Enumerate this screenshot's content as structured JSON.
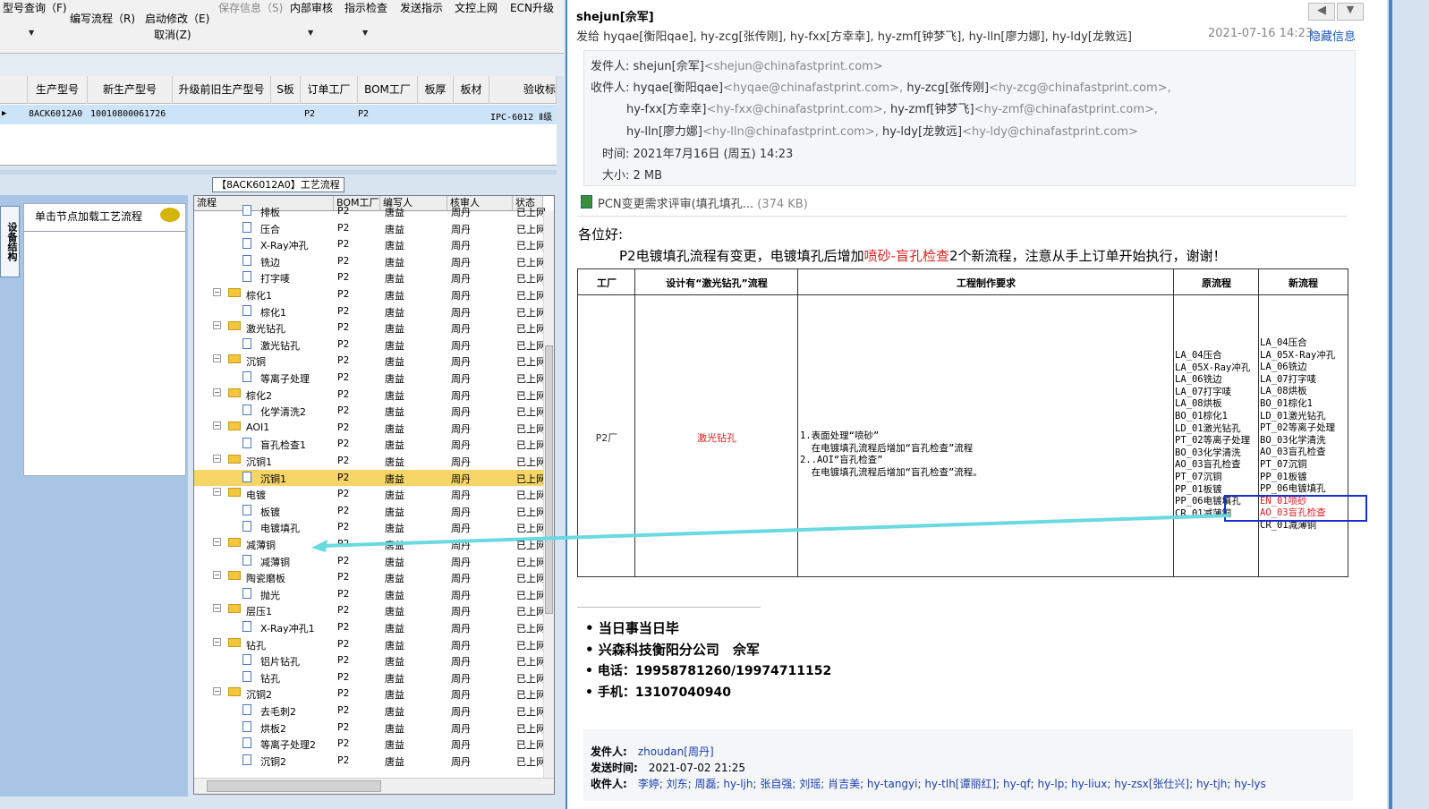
{
  "toolbar": {
    "items": [
      "型号查询（F)",
      "编写流程（R)",
      "启动修改（E)",
      "保存信息（S)",
      "内部审核",
      "指示检查",
      "发送指示",
      "文控上网",
      "ECN升级"
    ],
    "cancel": "取消(Z)"
  },
  "grid": {
    "headers": [
      "生产型号",
      "新生产型号",
      "升级前旧生产型号",
      "S板",
      "订单工厂",
      "BOM工厂",
      "板厚",
      "板材",
      "验收标"
    ],
    "row": {
      "model": "8ACK6012A0",
      "new_model": "10010800061726",
      "s": "",
      "order_factory": "P2",
      "bom_factory": "P2",
      "standard": "IPC-6012 Ⅱ级"
    }
  },
  "workflow_title": "【8ACK6012A0】工艺流程",
  "side_tab": "设备结构",
  "hint_panel": {
    "title": "单击节点加载工艺流程"
  },
  "tree": {
    "headers": [
      "流程",
      "BOM工厂",
      "编写人",
      "核审人",
      "状态"
    ],
    "rows": [
      {
        "level": 2,
        "type": "doc",
        "name": "排板",
        "bom": "P2",
        "author": "唐益",
        "reviewer": "周丹",
        "status": "已上网"
      },
      {
        "level": 2,
        "type": "doc",
        "name": "压合",
        "bom": "P2",
        "author": "唐益",
        "reviewer": "周丹",
        "status": "已上网"
      },
      {
        "level": 2,
        "type": "doc",
        "name": "X-Ray冲孔",
        "bom": "P2",
        "author": "唐益",
        "reviewer": "周丹",
        "status": "已上网"
      },
      {
        "level": 2,
        "type": "doc",
        "name": "铣边",
        "bom": "P2",
        "author": "唐益",
        "reviewer": "周丹",
        "status": "已上网"
      },
      {
        "level": 2,
        "type": "doc",
        "name": "打字唛",
        "bom": "P2",
        "author": "唐益",
        "reviewer": "周丹",
        "status": "已上网"
      },
      {
        "level": 1,
        "type": "folder",
        "name": "棕化1",
        "bom": "P2",
        "author": "唐益",
        "reviewer": "周丹",
        "status": "已上网"
      },
      {
        "level": 2,
        "type": "doc",
        "name": "棕化1",
        "bom": "P2",
        "author": "唐益",
        "reviewer": "周丹",
        "status": "已上网"
      },
      {
        "level": 1,
        "type": "folder",
        "name": "激光钻孔",
        "bom": "P2",
        "author": "唐益",
        "reviewer": "周丹",
        "status": "已上网"
      },
      {
        "level": 2,
        "type": "doc",
        "name": "激光钻孔",
        "bom": "P2",
        "author": "唐益",
        "reviewer": "周丹",
        "status": "已上网"
      },
      {
        "level": 1,
        "type": "folder",
        "name": "沉铜",
        "bom": "P2",
        "author": "唐益",
        "reviewer": "周丹",
        "status": "已上网"
      },
      {
        "level": 2,
        "type": "doc",
        "name": "等离子处理",
        "bom": "P2",
        "author": "唐益",
        "reviewer": "周丹",
        "status": "已上网"
      },
      {
        "level": 1,
        "type": "folder",
        "name": "棕化2",
        "bom": "P2",
        "author": "唐益",
        "reviewer": "周丹",
        "status": "已上网"
      },
      {
        "level": 2,
        "type": "doc",
        "name": "化学清洗2",
        "bom": "P2",
        "author": "唐益",
        "reviewer": "周丹",
        "status": "已上网"
      },
      {
        "level": 1,
        "type": "folder",
        "name": "AOI1",
        "bom": "P2",
        "author": "唐益",
        "reviewer": "周丹",
        "status": "已上网"
      },
      {
        "level": 2,
        "type": "doc",
        "name": "盲孔检查1",
        "bom": "P2",
        "author": "唐益",
        "reviewer": "周丹",
        "status": "已上网"
      },
      {
        "level": 1,
        "type": "folder",
        "name": "沉铜1",
        "bom": "P2",
        "author": "唐益",
        "reviewer": "周丹",
        "status": "已上网"
      },
      {
        "level": 2,
        "type": "doc",
        "name": "沉铜1",
        "bom": "P2",
        "author": "唐益",
        "reviewer": "周丹",
        "status": "已上网",
        "selected": true
      },
      {
        "level": 1,
        "type": "folder",
        "name": "电镀",
        "bom": "P2",
        "author": "唐益",
        "reviewer": "周丹",
        "status": "已上网"
      },
      {
        "level": 2,
        "type": "doc",
        "name": "板镀",
        "bom": "P2",
        "author": "唐益",
        "reviewer": "周丹",
        "status": "已上网"
      },
      {
        "level": 2,
        "type": "doc",
        "name": "电镀填孔",
        "bom": "P2",
        "author": "唐益",
        "reviewer": "周丹",
        "status": "已上网"
      },
      {
        "level": 1,
        "type": "folder",
        "name": "减薄铜",
        "bom": "P2",
        "author": "唐益",
        "reviewer": "周丹",
        "status": "已上网"
      },
      {
        "level": 2,
        "type": "doc",
        "name": "减薄铜",
        "bom": "P2",
        "author": "唐益",
        "reviewer": "周丹",
        "status": "已上网"
      },
      {
        "level": 1,
        "type": "folder",
        "name": "陶瓷磨板",
        "bom": "P2",
        "author": "唐益",
        "reviewer": "周丹",
        "status": "已上网"
      },
      {
        "level": 2,
        "type": "doc",
        "name": "抛光",
        "bom": "P2",
        "author": "唐益",
        "reviewer": "周丹",
        "status": "已上网"
      },
      {
        "level": 1,
        "type": "folder",
        "name": "层压1",
        "bom": "P2",
        "author": "唐益",
        "reviewer": "周丹",
        "status": "已上网"
      },
      {
        "level": 2,
        "type": "doc",
        "name": "X-Ray冲孔1",
        "bom": "P2",
        "author": "唐益",
        "reviewer": "周丹",
        "status": "已上网"
      },
      {
        "level": 1,
        "type": "folder",
        "name": "钻孔",
        "bom": "P2",
        "author": "唐益",
        "reviewer": "周丹",
        "status": "已上网"
      },
      {
        "level": 2,
        "type": "doc",
        "name": "铝片钻孔",
        "bom": "P2",
        "author": "唐益",
        "reviewer": "周丹",
        "status": "已上网"
      },
      {
        "level": 2,
        "type": "doc",
        "name": "钻孔",
        "bom": "P2",
        "author": "唐益",
        "reviewer": "周丹",
        "status": "已上网"
      },
      {
        "level": 1,
        "type": "folder",
        "name": "沉铜2",
        "bom": "P2",
        "author": "唐益",
        "reviewer": "周丹",
        "status": "已上网"
      },
      {
        "level": 2,
        "type": "doc",
        "name": "去毛刺2",
        "bom": "P2",
        "author": "唐益",
        "reviewer": "周丹",
        "status": "已上网"
      },
      {
        "level": 2,
        "type": "doc",
        "name": "烘板2",
        "bom": "P2",
        "author": "唐益",
        "reviewer": "周丹",
        "status": "已上网"
      },
      {
        "level": 2,
        "type": "doc",
        "name": "等离子处理2",
        "bom": "P2",
        "author": "唐益",
        "reviewer": "周丹",
        "status": "已上网"
      },
      {
        "level": 2,
        "type": "doc",
        "name": "沉铜2",
        "bom": "P2",
        "author": "唐益",
        "reviewer": "周丹",
        "status": "已上网"
      }
    ]
  },
  "email": {
    "sender_name": "shejun[佘军]",
    "sent_to": "发给 hyqae[衡阳qae], hy-zcg[张传刚], hy-fxx[方幸幸], hy-zmf[钟梦飞], hy-lln[廖力娜], hy-ldy[龙敦远]",
    "datetime": "2021-07-16 14:23",
    "hide_info": "隐藏信息",
    "from_label": "发件人:",
    "from_name": "shejun[佘军]",
    "from_addr": "<shejun@chinafastprint.com>",
    "to_label": "收件人:",
    "to_lines": [
      {
        "n1": "hyqae[衡阳qae]",
        "a1": "<hyqae@chinafastprint.com>,",
        "n2": "hy-zcg[张传刚]",
        "a2": "<hy-zcg@chinafastprint.com>,"
      },
      {
        "n1": "hy-fxx[方幸幸]",
        "a1": "<hy-fxx@chinafastprint.com>,",
        "n2": "hy-zmf[钟梦飞]",
        "a2": "<hy-zmf@chinafastprint.com>,"
      },
      {
        "n1": "hy-lln[廖力娜]",
        "a1": "<hy-lln@chinafastprint.com>,",
        "n2": "hy-ldy[龙敦远]",
        "a2": "<hy-ldy@chinafastprint.com>"
      }
    ],
    "time_line": "时间: 2021年7月16日 (周五) 14:23",
    "size_line": "大小: 2 MB",
    "attachment": "PCN变更需求评审(填孔填孔...",
    "attachment_size": "(374 KB)",
    "greeting": "各位好:",
    "body_pre": "P2电镀填孔流程有变更，电镀填孔后增加",
    "body_red": "喷砂-盲孔检查",
    "body_post": "2个新流程，注意从手上订单开始执行，谢谢！",
    "table": {
      "headers": [
        "工厂",
        "设计有“激光钻孔”流程",
        "工程制作要求",
        "原流程",
        "新流程"
      ],
      "factory": "P2厂",
      "design": "激光钻孔",
      "req_lines": [
        "1.表面处理“喷砂”",
        "  在电镀填孔流程后增加“盲孔检查”流程",
        "2..AOI“盲孔检查”",
        "  在电镀填孔流程后增加“盲孔检查”流程。"
      ],
      "old_flow": [
        "LA_04压合",
        "LA_05X-Ray冲孔",
        "LA_06铣边",
        "LA_07打字唛",
        "LA_08烘板",
        "BO_01棕化1",
        "LD_01激光钻孔",
        "PT_02等离子处理",
        "BO_03化学清洗",
        "AO_03盲孔检查",
        "PT_07沉铜",
        "PP_01板镀",
        "PP_06电镀填孔",
        "CR_01减薄铜"
      ],
      "new_flow": [
        "LA_04压合",
        "LA_05X-Ray冲孔",
        "LA_06铣边",
        "LA_07打字唛",
        "LA_08烘板",
        "BO_01棕化1",
        "LD_01激光钻孔",
        "PT_02等离子处理",
        "BO_03化学清洗",
        "AO_03盲孔检查",
        "PT_07沉铜",
        "PP_01板镀",
        "PP_06电镀填孔",
        "EN_01喷砂",
        "AO_03盲孔检查",
        "CR_01减薄铜"
      ]
    },
    "signature": [
      "当日事当日毕",
      "兴森科技衡阳分公司　佘军",
      "电话：19958781260/19974711152",
      "手机：13107040940"
    ],
    "quoted": {
      "from_label": "发件人:",
      "from": "zhoudan[周丹]",
      "time_label": "发送时间:",
      "time": "2021-07-02 21:25",
      "to_label": "收件人:",
      "to": "李婷; 刘东; 周磊; hy-ljh; 张自强; 刘瑶; 肖吉美; hy-tangyi; hy-tlh[谭丽红]; hy-qf; hy-lp; hy-liux; hy-zsx[张仕兴]; hy-tjh; hy-lys"
    }
  },
  "colors": {
    "selection": "#f5d568",
    "accent_red": "#e02020",
    "link": "#1a3fb0",
    "arrow": "#6ad9e0",
    "highlight_box": "#1a2fd0"
  }
}
